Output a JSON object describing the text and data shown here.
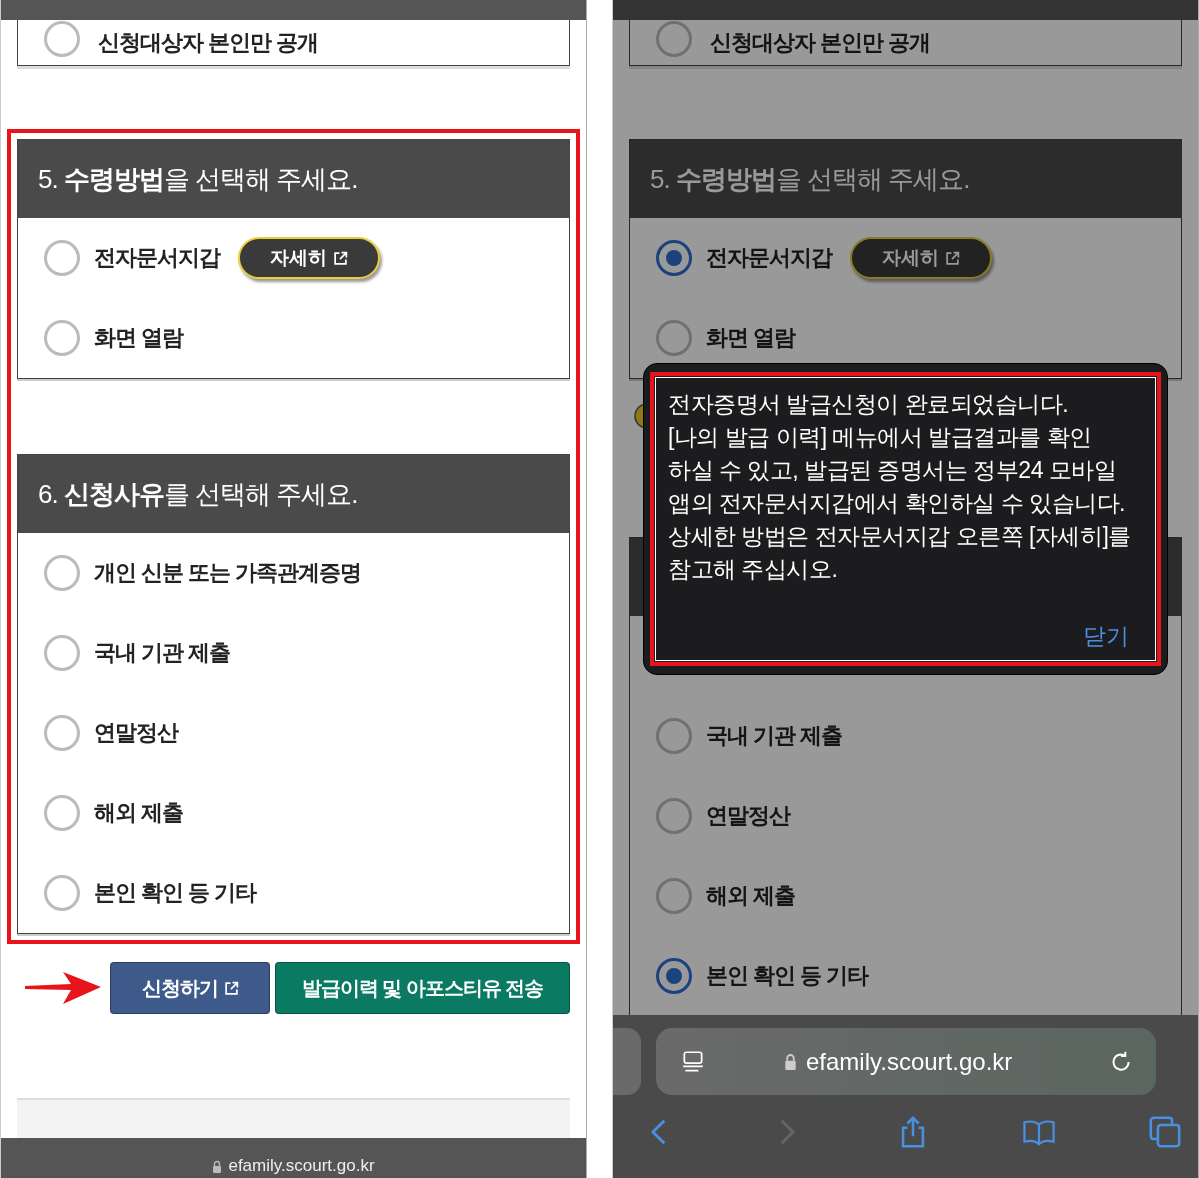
{
  "screens": [
    {
      "dimmed": false,
      "previous_option": {
        "label": "신청대상자 본인만 공개",
        "selected": false
      },
      "highlighted": true,
      "sections": [
        {
          "title": "5. **수령방법**을 선택해 주세요.",
          "options": [
            {
              "label": "전자문서지갑",
              "selected": false,
              "detail_button": "자세히"
            },
            {
              "label": "화면 열람",
              "selected": false
            }
          ]
        },
        {
          "title": "6. **신청사유**를 선택해 주세요.",
          "options": [
            {
              "label": "개인 신분 또는 가족관계증명",
              "selected": false
            },
            {
              "label": "국내 기관 제출",
              "selected": false
            },
            {
              "label": "연말정산",
              "selected": false
            },
            {
              "label": "해외 제출",
              "selected": false
            },
            {
              "label": "본인 확인 등 기타",
              "selected": false
            }
          ]
        }
      ],
      "pointer_arrow": true,
      "buttons": [
        {
          "label": "신청하기",
          "kind": "primary",
          "external": true
        },
        {
          "label": "발급이력 및 아포스티유 전송",
          "kind": "secondary",
          "external": false
        }
      ],
      "browser_bar": {
        "kind": "compact",
        "url": "efamily.scourt.go.kr"
      }
    },
    {
      "dimmed": true,
      "previous_option": {
        "label": "신청대상자 본인만 공개",
        "selected": false
      },
      "highlighted": false,
      "sections": [
        {
          "title": "5. **수령방법**을 선택해 주세요.",
          "options": [
            {
              "label": "전자문서지갑",
              "selected": true,
              "detail_button": "자세히"
            },
            {
              "label": "화면 열람",
              "selected": false
            }
          ]
        },
        {
          "options": [
            {
              "label": "국내 기관 제출",
              "selected": false
            },
            {
              "label": "연말정산",
              "selected": false
            },
            {
              "label": "해외 제출",
              "selected": false
            },
            {
              "label": "본인 확인 등 기타",
              "selected": true
            }
          ]
        }
      ],
      "dialog": {
        "highlighted": true,
        "message": "전자증명서 발급신청이 완료되었습니다.\n[나의 발급 이력] 메뉴에서 발급결과를 확인\n하실 수 있고, 발급된 증명서는 정부24 모바일\n앱의 전자문서지갑에서 확인하실 수 있습니다.\n상세한 방법은 전자문서지갑 오른쪽 [자세히]를\n참고해 주십시오.",
        "close": "닫기"
      },
      "browser_bar": {
        "kind": "full",
        "url": "efamily.scourt.go.kr"
      }
    }
  ]
}
